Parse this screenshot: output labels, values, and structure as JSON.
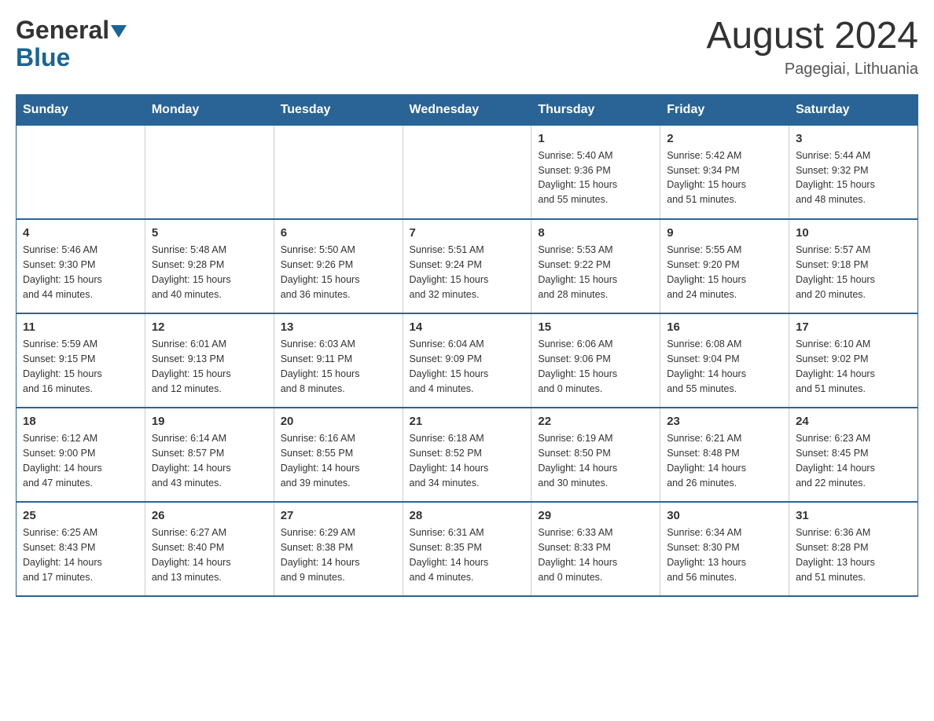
{
  "header": {
    "logo_general": "General",
    "logo_blue": "Blue",
    "month_year": "August 2024",
    "location": "Pagegiai, Lithuania"
  },
  "weekdays": [
    "Sunday",
    "Monday",
    "Tuesday",
    "Wednesday",
    "Thursday",
    "Friday",
    "Saturday"
  ],
  "weeks": [
    [
      {
        "day": "",
        "info": ""
      },
      {
        "day": "",
        "info": ""
      },
      {
        "day": "",
        "info": ""
      },
      {
        "day": "",
        "info": ""
      },
      {
        "day": "1",
        "info": "Sunrise: 5:40 AM\nSunset: 9:36 PM\nDaylight: 15 hours\nand 55 minutes."
      },
      {
        "day": "2",
        "info": "Sunrise: 5:42 AM\nSunset: 9:34 PM\nDaylight: 15 hours\nand 51 minutes."
      },
      {
        "day": "3",
        "info": "Sunrise: 5:44 AM\nSunset: 9:32 PM\nDaylight: 15 hours\nand 48 minutes."
      }
    ],
    [
      {
        "day": "4",
        "info": "Sunrise: 5:46 AM\nSunset: 9:30 PM\nDaylight: 15 hours\nand 44 minutes."
      },
      {
        "day": "5",
        "info": "Sunrise: 5:48 AM\nSunset: 9:28 PM\nDaylight: 15 hours\nand 40 minutes."
      },
      {
        "day": "6",
        "info": "Sunrise: 5:50 AM\nSunset: 9:26 PM\nDaylight: 15 hours\nand 36 minutes."
      },
      {
        "day": "7",
        "info": "Sunrise: 5:51 AM\nSunset: 9:24 PM\nDaylight: 15 hours\nand 32 minutes."
      },
      {
        "day": "8",
        "info": "Sunrise: 5:53 AM\nSunset: 9:22 PM\nDaylight: 15 hours\nand 28 minutes."
      },
      {
        "day": "9",
        "info": "Sunrise: 5:55 AM\nSunset: 9:20 PM\nDaylight: 15 hours\nand 24 minutes."
      },
      {
        "day": "10",
        "info": "Sunrise: 5:57 AM\nSunset: 9:18 PM\nDaylight: 15 hours\nand 20 minutes."
      }
    ],
    [
      {
        "day": "11",
        "info": "Sunrise: 5:59 AM\nSunset: 9:15 PM\nDaylight: 15 hours\nand 16 minutes."
      },
      {
        "day": "12",
        "info": "Sunrise: 6:01 AM\nSunset: 9:13 PM\nDaylight: 15 hours\nand 12 minutes."
      },
      {
        "day": "13",
        "info": "Sunrise: 6:03 AM\nSunset: 9:11 PM\nDaylight: 15 hours\nand 8 minutes."
      },
      {
        "day": "14",
        "info": "Sunrise: 6:04 AM\nSunset: 9:09 PM\nDaylight: 15 hours\nand 4 minutes."
      },
      {
        "day": "15",
        "info": "Sunrise: 6:06 AM\nSunset: 9:06 PM\nDaylight: 15 hours\nand 0 minutes."
      },
      {
        "day": "16",
        "info": "Sunrise: 6:08 AM\nSunset: 9:04 PM\nDaylight: 14 hours\nand 55 minutes."
      },
      {
        "day": "17",
        "info": "Sunrise: 6:10 AM\nSunset: 9:02 PM\nDaylight: 14 hours\nand 51 minutes."
      }
    ],
    [
      {
        "day": "18",
        "info": "Sunrise: 6:12 AM\nSunset: 9:00 PM\nDaylight: 14 hours\nand 47 minutes."
      },
      {
        "day": "19",
        "info": "Sunrise: 6:14 AM\nSunset: 8:57 PM\nDaylight: 14 hours\nand 43 minutes."
      },
      {
        "day": "20",
        "info": "Sunrise: 6:16 AM\nSunset: 8:55 PM\nDaylight: 14 hours\nand 39 minutes."
      },
      {
        "day": "21",
        "info": "Sunrise: 6:18 AM\nSunset: 8:52 PM\nDaylight: 14 hours\nand 34 minutes."
      },
      {
        "day": "22",
        "info": "Sunrise: 6:19 AM\nSunset: 8:50 PM\nDaylight: 14 hours\nand 30 minutes."
      },
      {
        "day": "23",
        "info": "Sunrise: 6:21 AM\nSunset: 8:48 PM\nDaylight: 14 hours\nand 26 minutes."
      },
      {
        "day": "24",
        "info": "Sunrise: 6:23 AM\nSunset: 8:45 PM\nDaylight: 14 hours\nand 22 minutes."
      }
    ],
    [
      {
        "day": "25",
        "info": "Sunrise: 6:25 AM\nSunset: 8:43 PM\nDaylight: 14 hours\nand 17 minutes."
      },
      {
        "day": "26",
        "info": "Sunrise: 6:27 AM\nSunset: 8:40 PM\nDaylight: 14 hours\nand 13 minutes."
      },
      {
        "day": "27",
        "info": "Sunrise: 6:29 AM\nSunset: 8:38 PM\nDaylight: 14 hours\nand 9 minutes."
      },
      {
        "day": "28",
        "info": "Sunrise: 6:31 AM\nSunset: 8:35 PM\nDaylight: 14 hours\nand 4 minutes."
      },
      {
        "day": "29",
        "info": "Sunrise: 6:33 AM\nSunset: 8:33 PM\nDaylight: 14 hours\nand 0 minutes."
      },
      {
        "day": "30",
        "info": "Sunrise: 6:34 AM\nSunset: 8:30 PM\nDaylight: 13 hours\nand 56 minutes."
      },
      {
        "day": "31",
        "info": "Sunrise: 6:36 AM\nSunset: 8:28 PM\nDaylight: 13 hours\nand 51 minutes."
      }
    ]
  ]
}
